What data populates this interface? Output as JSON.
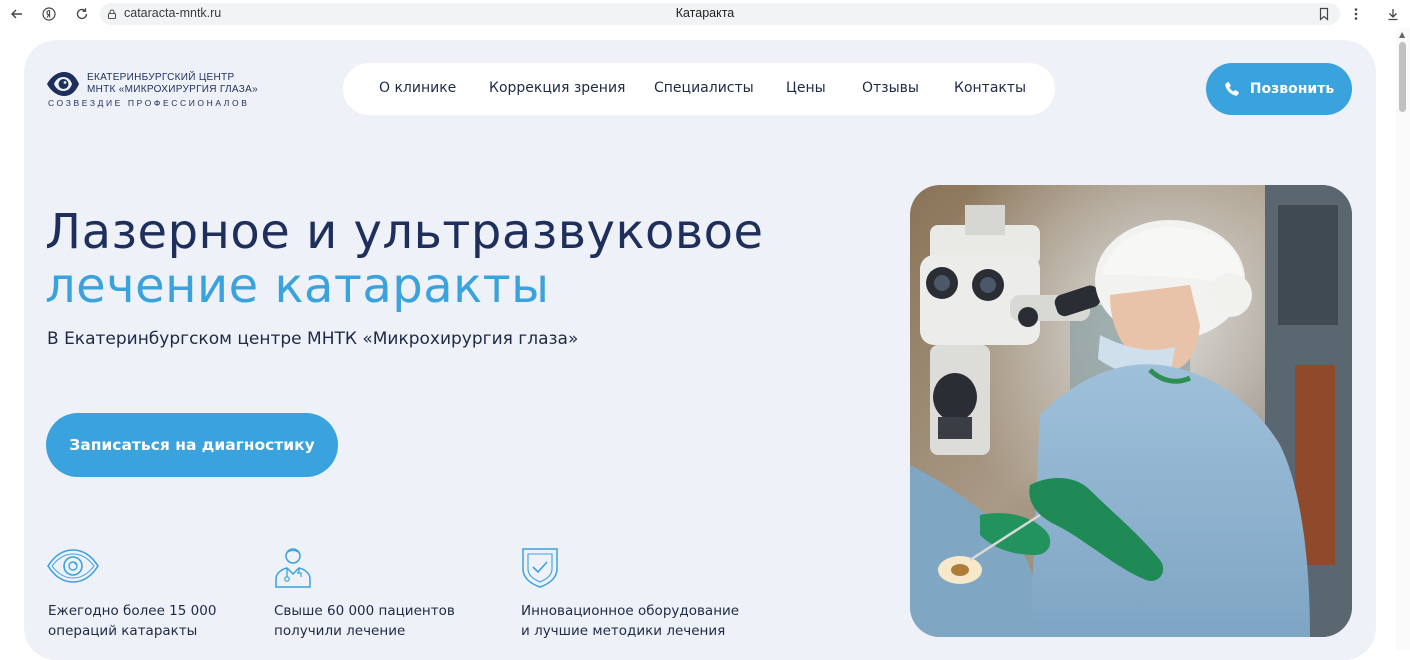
{
  "browser": {
    "url": "cataracta-mntk.ru",
    "tab_title": "Катаракта"
  },
  "logo": {
    "line1": "ЕКАТЕРИНБУРГСКИЙ ЦЕНТР",
    "line2": "МНТК «МИКРОХИРУРГИЯ ГЛАЗА»",
    "line3": "СОЗВЕЗДИЕ ПРОФЕССИОНАЛОВ"
  },
  "nav": {
    "items": [
      {
        "label": "О клинике"
      },
      {
        "label": "Коррекция зрения"
      },
      {
        "label": "Специалисты"
      },
      {
        "label": "Цены"
      },
      {
        "label": "Отзывы"
      },
      {
        "label": "Контакты"
      }
    ]
  },
  "call_button": {
    "label": "Позвонить"
  },
  "hero": {
    "title_line1": "Лазерное и ультразвуковое",
    "title_line2": "лечение катаракты",
    "subtitle": "В Екатеринбургском центре МНТК «Микрохирургия глаза»",
    "cta": "Записаться на диагностику"
  },
  "features": [
    {
      "icon": "eye-icon",
      "line1": "Ежегодно более 15 000",
      "line2": "операций катаракты"
    },
    {
      "icon": "doctor-icon",
      "line1": "Свыше 60 000 пациентов",
      "line2": "получили лечение"
    },
    {
      "icon": "shield-check-icon",
      "line1": "Инновационное оборудование",
      "line2": "и лучшие методики лечения"
    }
  ],
  "colors": {
    "accent": "#3aa3de",
    "navy": "#1e2f5c",
    "page_bg": "#eef1f8"
  }
}
